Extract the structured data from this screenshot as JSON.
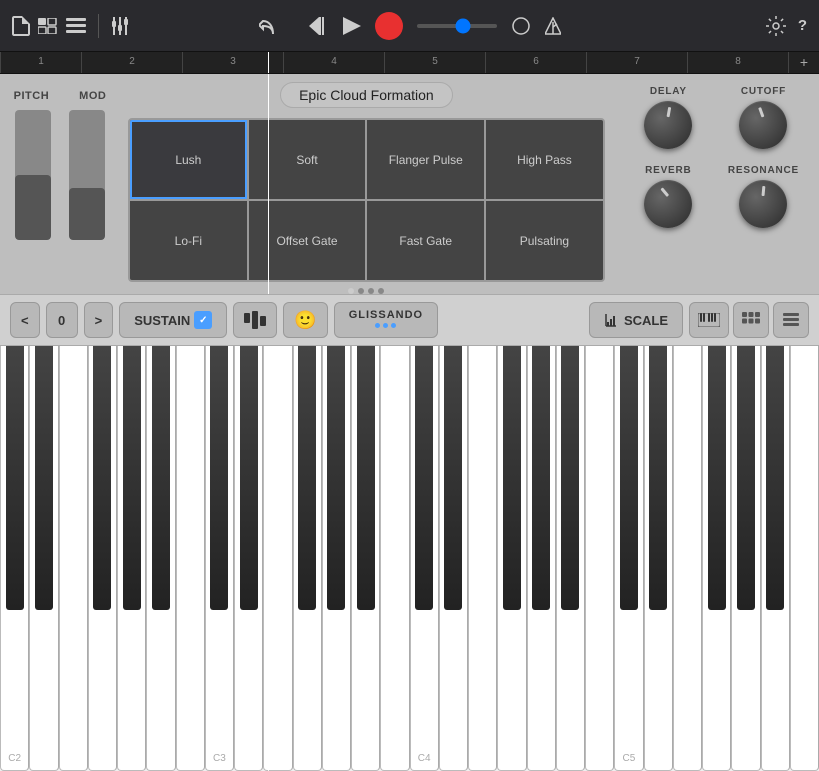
{
  "toolbar": {
    "transport": {
      "rewind_label": "⏮",
      "play_label": "▶",
      "record_label": "●"
    },
    "icons": {
      "file": "📄",
      "scenes": "⊞",
      "tracks": "≡",
      "mixer": "⧎",
      "undo": "↩",
      "metronome": "🔔",
      "tempo": "◬",
      "settings": "⚙",
      "help": "?"
    }
  },
  "ruler": {
    "marks": [
      "1",
      "2",
      "3",
      "4",
      "5",
      "6",
      "7",
      "8",
      "+"
    ]
  },
  "preset": {
    "name": "Epic Cloud Formation"
  },
  "pads": {
    "rows": [
      [
        {
          "label": "Lush",
          "active": true
        },
        {
          "label": "Soft",
          "active": false
        },
        {
          "label": "Flanger Pulse",
          "active": false
        },
        {
          "label": "High Pass",
          "active": false
        }
      ],
      [
        {
          "label": "Lo-Fi",
          "active": false
        },
        {
          "label": "Offset Gate",
          "active": false
        },
        {
          "label": "Fast Gate",
          "active": false
        },
        {
          "label": "Pulsating",
          "active": false
        }
      ]
    ],
    "page_dots": [
      true,
      false,
      false,
      false
    ]
  },
  "knobs": [
    {
      "id": "delay",
      "label": "DELAY",
      "angle": 10
    },
    {
      "id": "cutoff",
      "label": "CUTOFF",
      "angle": -20
    },
    {
      "id": "reverb",
      "label": "REVERB",
      "angle": -40
    },
    {
      "id": "resonance",
      "label": "RESONANCE",
      "angle": 5
    }
  ],
  "bottom_controls": {
    "prev_label": "<",
    "octave_value": "0",
    "next_label": ">",
    "sustain_label": "SUSTAIN",
    "arp_label": "🎹",
    "emoji_label": "🙂",
    "glissando_label": "GLISSANDO",
    "glissando_dots": [
      "#4a9eff",
      "#4a9eff",
      "#4a9eff"
    ],
    "scale_label": "SCALE",
    "view1_label": "▦",
    "view2_label": "⠿",
    "view3_label": "☰"
  },
  "keyboard": {
    "note_labels": [
      {
        "note": "C2",
        "position": 0.03
      },
      {
        "note": "C3",
        "position": 0.38
      },
      {
        "note": "C4",
        "position": 0.74
      }
    ],
    "white_keys_count": 28,
    "black_key_positions": [
      0.5,
      1.5,
      3.5,
      4.5,
      5.5,
      7.5,
      8.5,
      10.5,
      11.5,
      12.5,
      14.5,
      15.5,
      17.5,
      18.5,
      19.5,
      21.5,
      22.5,
      24.5,
      25.5,
      26.5
    ]
  }
}
